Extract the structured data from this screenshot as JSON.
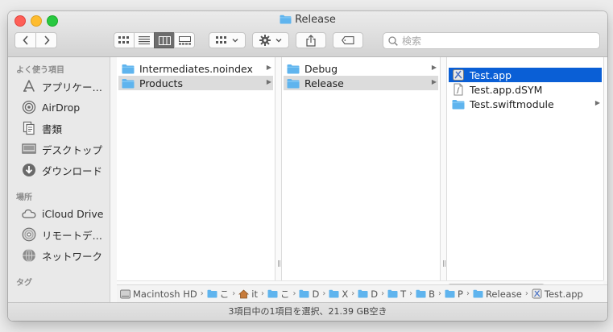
{
  "window": {
    "title": "Release"
  },
  "toolbar": {
    "back_icon": "chevron-left-icon",
    "forward_icon": "chevron-right-icon",
    "view_modes": [
      "icon-view",
      "list-view",
      "column-view",
      "gallery-view"
    ],
    "active_view": "column-view",
    "search_placeholder": "検索"
  },
  "sidebar": {
    "favorites_header": "よく使う項目",
    "favorites": [
      {
        "label": "アプリケー…",
        "icon": "applications-icon"
      },
      {
        "label": "AirDrop",
        "icon": "airdrop-icon"
      },
      {
        "label": "書類",
        "icon": "documents-icon"
      },
      {
        "label": "デスクトップ",
        "icon": "desktop-icon"
      },
      {
        "label": "ダウンロード",
        "icon": "downloads-icon"
      }
    ],
    "locations_header": "場所",
    "locations": [
      {
        "label": "iCloud Drive",
        "icon": "icloud-icon"
      },
      {
        "label": "リモートデ…",
        "icon": "remote-disc-icon"
      },
      {
        "label": "ネットワーク",
        "icon": "network-icon"
      }
    ],
    "tags_header": "タグ"
  },
  "columns": [
    {
      "items": [
        {
          "label": "Intermediates.noindex",
          "kind": "folder",
          "arrow": true,
          "selected": ""
        },
        {
          "label": "Products",
          "kind": "folder",
          "arrow": true,
          "selected": "grey"
        }
      ]
    },
    {
      "items": [
        {
          "label": "Debug",
          "kind": "folder",
          "arrow": true,
          "selected": ""
        },
        {
          "label": "Release",
          "kind": "folder",
          "arrow": true,
          "selected": "grey"
        }
      ]
    },
    {
      "items": [
        {
          "label": "Test.app",
          "kind": "app",
          "arrow": false,
          "selected": "blue"
        },
        {
          "label": "Test.app.dSYM",
          "kind": "file",
          "arrow": false,
          "selected": ""
        },
        {
          "label": "Test.swiftmodule",
          "kind": "folder",
          "arrow": true,
          "selected": ""
        }
      ]
    }
  ],
  "pathbar": {
    "crumbs": [
      {
        "label": "Macintosh HD",
        "icon": "hard-drive-icon"
      },
      {
        "label": "こ",
        "icon": "folder-icon"
      },
      {
        "label": "it",
        "icon": "home-icon"
      },
      {
        "label": "こ",
        "icon": "folder-icon"
      },
      {
        "label": "D",
        "icon": "folder-icon"
      },
      {
        "label": "X",
        "icon": "folder-icon"
      },
      {
        "label": "D",
        "icon": "folder-icon"
      },
      {
        "label": "T",
        "icon": "folder-icon"
      },
      {
        "label": "B",
        "icon": "folder-icon"
      },
      {
        "label": "P",
        "icon": "folder-icon"
      },
      {
        "label": "Release",
        "icon": "folder-icon"
      },
      {
        "label": "Test.app",
        "icon": "app-icon"
      }
    ]
  },
  "status": {
    "text": "3項目中の1項目を選択、21.39 GB空き"
  },
  "colors": {
    "folder": "#5fb4ee",
    "selection_blue": "#0a5fd6",
    "selection_grey": "#dcdcdc"
  }
}
